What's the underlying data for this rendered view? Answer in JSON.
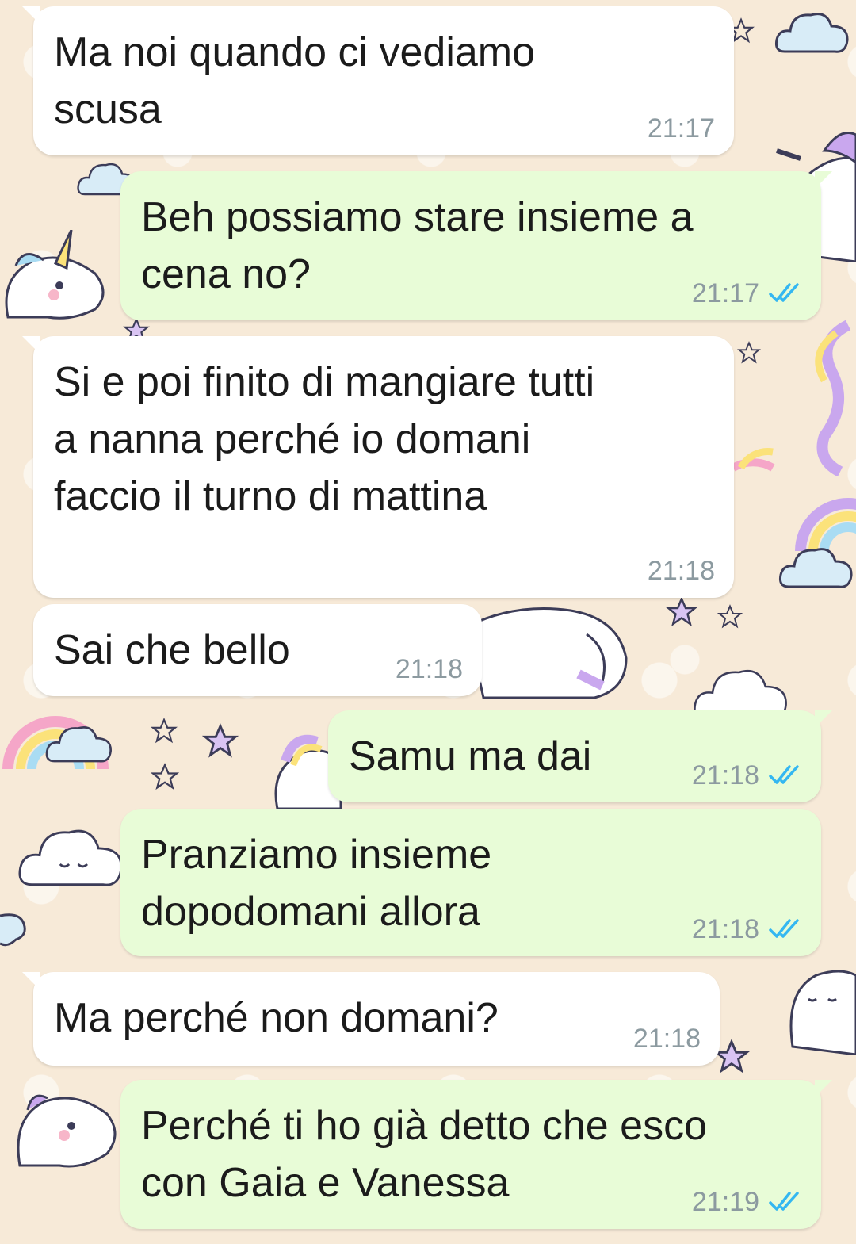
{
  "colors": {
    "incoming_bubble": "#ffffff",
    "outgoing_bubble": "#e8fcd7",
    "timestamp": "#8c9aa0",
    "read_ticks": "#34b7f1",
    "wallpaper": "#f7ead8"
  },
  "wallpaper": {
    "icons": [
      "unicorn-icon",
      "rainbow-icon",
      "cloud-icon",
      "star-icon"
    ]
  },
  "chat": {
    "messages": [
      {
        "direction": "incoming",
        "text": "Ma noi quando ci vediamo\nscusa",
        "time": "21:17"
      },
      {
        "direction": "outgoing",
        "text": "Beh possiamo stare insieme a\ncena no?",
        "time": "21:17",
        "status": "read"
      },
      {
        "direction": "incoming",
        "text": "Si e poi finito di mangiare tutti\na nanna perché io domani\nfaccio il turno di mattina",
        "time": "21:18"
      },
      {
        "direction": "incoming",
        "text": "Sai che bello",
        "time": "21:18"
      },
      {
        "direction": "outgoing",
        "text": "Samu ma dai",
        "time": "21:18",
        "status": "read"
      },
      {
        "direction": "outgoing",
        "text": "Pranziamo insieme\ndopodomani allora",
        "time": "21:18",
        "status": "read"
      },
      {
        "direction": "incoming",
        "text": "Ma perché non domani?",
        "time": "21:18"
      },
      {
        "direction": "outgoing",
        "text": "Perché ti ho già detto che esco\ncon Gaia e Vanessa",
        "time": "21:19",
        "status": "read"
      }
    ]
  }
}
